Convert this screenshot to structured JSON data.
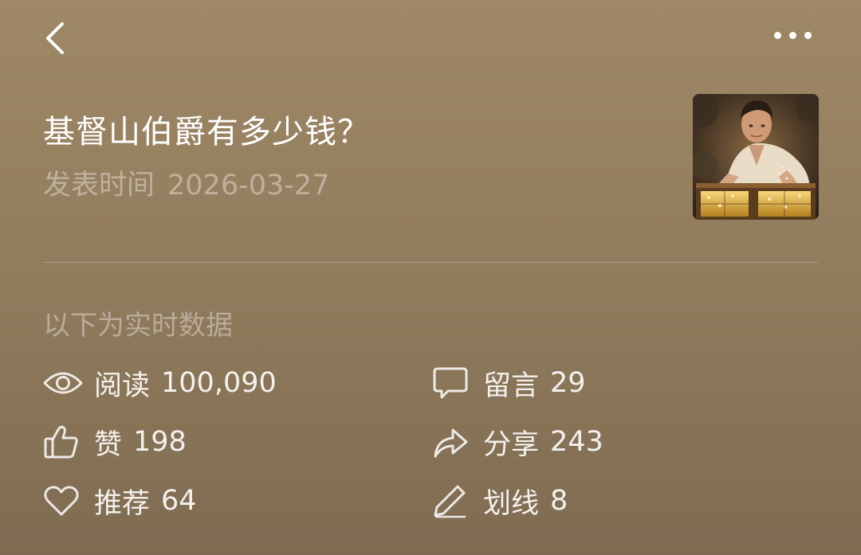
{
  "header": {
    "back_icon": "chevron-left-icon",
    "more_icon": "more-dots-icon"
  },
  "article": {
    "title": "基督山伯爵有多少钱？",
    "publish_label": "发表时间",
    "publish_date": "2026-03-27",
    "thumbnail_icon": "article-cover-image"
  },
  "stats": {
    "note": "以下为实时数据",
    "reads": {
      "label": "阅读",
      "value": "100,090",
      "icon": "eye-icon"
    },
    "comments": {
      "label": "留言",
      "value": "29",
      "icon": "comment-icon"
    },
    "likes": {
      "label": "赞",
      "value": "198",
      "icon": "thumbs-up-icon"
    },
    "shares": {
      "label": "分享",
      "value": "243",
      "icon": "share-icon"
    },
    "recommends": {
      "label": "推荐",
      "value": "64",
      "icon": "heart-icon"
    },
    "highlights": {
      "label": "划线",
      "value": "8",
      "icon": "pen-icon"
    }
  },
  "colors": {
    "background_top": "#9e8866",
    "background_bottom": "#7f6b51",
    "text": "#ffffff"
  }
}
